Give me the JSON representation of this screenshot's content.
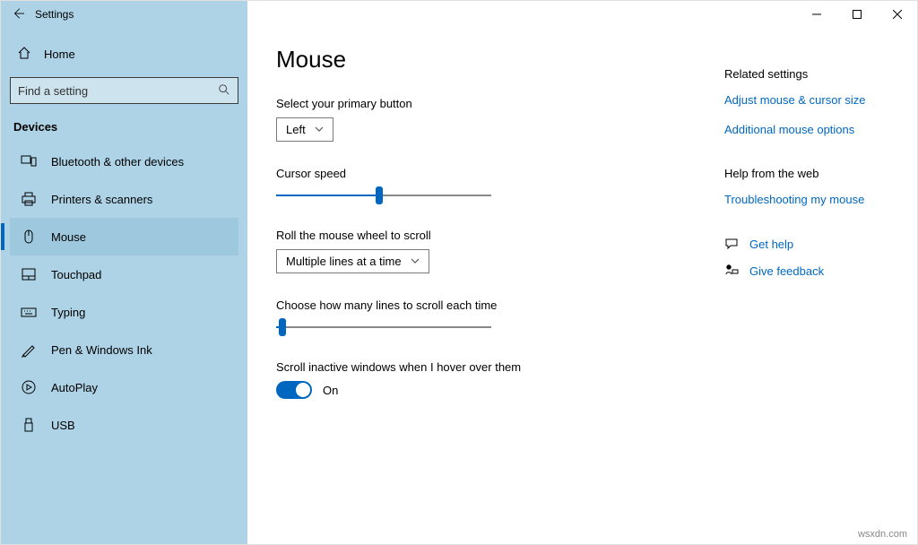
{
  "window": {
    "title": "Settings"
  },
  "search": {
    "placeholder": "Find a setting"
  },
  "home": "Home",
  "category": "Devices",
  "nav": {
    "bluetooth": "Bluetooth & other devices",
    "printers": "Printers & scanners",
    "mouse": "Mouse",
    "touchpad": "Touchpad",
    "typing": "Typing",
    "pen": "Pen & Windows Ink",
    "autoplay": "AutoPlay",
    "usb": "USB"
  },
  "page": {
    "title": "Mouse",
    "primary_label": "Select your primary button",
    "primary_value": "Left",
    "cursor_speed_label": "Cursor speed",
    "cursor_speed_pct": 48,
    "wheel_label": "Roll the mouse wheel to scroll",
    "wheel_value": "Multiple lines at a time",
    "lines_label": "Choose how many lines to scroll each time",
    "lines_pct": 3,
    "inactive_label": "Scroll inactive windows when I hover over them",
    "inactive_state": "On"
  },
  "related": {
    "heading": "Related settings",
    "adjust": "Adjust mouse & cursor size",
    "additional": "Additional mouse options",
    "help_heading": "Help from the web",
    "troubleshoot": "Troubleshooting my mouse",
    "get_help": "Get help",
    "feedback": "Give feedback"
  },
  "brand": "wsxdn.com"
}
